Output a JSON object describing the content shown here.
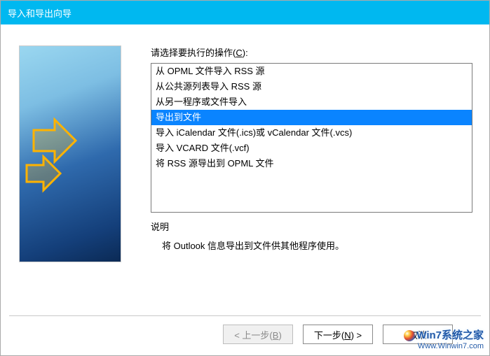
{
  "window": {
    "title": "导入和导出向导"
  },
  "content": {
    "prompt_prefix": "请选择要执行的操作(",
    "prompt_accel": "C",
    "prompt_suffix": "):",
    "options": [
      "从 OPML 文件导入 RSS 源",
      "从公共源列表导入 RSS 源",
      "从另一程序或文件导入",
      "导出到文件",
      "导入 iCalendar 文件(.ics)或 vCalendar 文件(.vcs)",
      "导入 VCARD 文件(.vcf)",
      "将 RSS 源导出到 OPML 文件"
    ],
    "selected_index": 3,
    "description_label": "说明",
    "description_text": "将 Outlook 信息导出到文件供其他程序使用。"
  },
  "buttons": {
    "back_prefix": "< 上一步(",
    "back_accel": "B",
    "back_suffix": ")",
    "next_prefix": "下一步(",
    "next_accel": "N",
    "next_suffix": ") >",
    "cancel": "取消"
  },
  "watermark": {
    "line1": "Win7系统之家",
    "line2": "Www.Winwin7.com"
  }
}
